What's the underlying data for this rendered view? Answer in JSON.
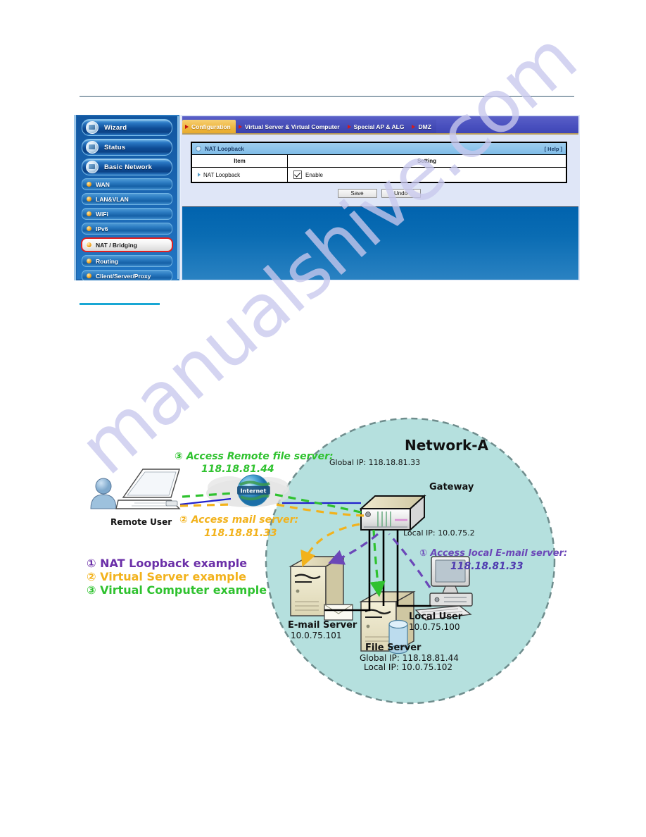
{
  "router_ui": {
    "sidebar": {
      "primary_items": [
        {
          "label": "Wizard",
          "icon": "wand-icon"
        },
        {
          "label": "Status",
          "icon": "chart-icon"
        },
        {
          "label": "Basic Network",
          "icon": "globe-icon"
        }
      ],
      "secondary_items": [
        {
          "label": "WAN",
          "active": false
        },
        {
          "label": "LAN&VLAN",
          "active": false
        },
        {
          "label": "WiFi",
          "active": false
        },
        {
          "label": "IPv6",
          "active": false
        },
        {
          "label": "NAT / Bridging",
          "active": true
        },
        {
          "label": "Routing",
          "active": false
        },
        {
          "label": "Client/Server/Proxy",
          "active": false
        }
      ]
    },
    "tabs": [
      {
        "label": "Configuration",
        "selected": true
      },
      {
        "label": "Virtual Server & Virtual Computer",
        "selected": false
      },
      {
        "label": "Special AP & ALG",
        "selected": false
      },
      {
        "label": "DMZ",
        "selected": false
      }
    ],
    "card": {
      "title": "NAT Loopback",
      "help_label": "[ Help ]",
      "columns": [
        "Item",
        "Setting"
      ],
      "rows": [
        {
          "item": "NAT Loopback",
          "setting_label": "Enable",
          "checked": true
        }
      ]
    },
    "buttons": {
      "save_label": "Save",
      "undo_label": "Undo"
    },
    "colors": {
      "selected_tab": "#eeb63f",
      "tab_bar": "#484fbe",
      "sidebar": "#1b63ab",
      "active_outline": "#e02020",
      "card_header": "#7fbde8"
    }
  },
  "diagram": {
    "network_label": "Network-A",
    "internet_label": "Internet",
    "nodes": {
      "remote_user": {
        "label": "Remote User"
      },
      "gateway": {
        "label": "Gateway",
        "global_ip": "Global IP: 118.18.81.33",
        "local_ip": "Local IP: 10.0.75.2"
      },
      "email_server": {
        "label": "E-mail Server",
        "ip": "10.0.75.101"
      },
      "file_server": {
        "label": "File Server",
        "global_ip": "Global IP: 118.18.81.44",
        "local_ip": "Local IP: 10.0.75.102"
      },
      "local_user": {
        "label": "Local User",
        "ip": "10.0.75.100"
      }
    },
    "flow_labels": [
      {
        "id": "flow-3",
        "line1": "③ Access Remote file server:",
        "line2": "118.18.81.44",
        "color": "#2fc22f"
      },
      {
        "id": "flow-2",
        "line1": "② Access mail server:",
        "line2": "118.18.81.33",
        "color": "#f2b21c"
      },
      {
        "id": "flow-1",
        "line1": "① Access local E-mail server:",
        "line2": "118.18.81.33",
        "color": "#6b47b8"
      }
    ],
    "legend": [
      {
        "text": "① NAT Loopback example",
        "color": "#6b2fa8"
      },
      {
        "text": "② Virtual Server example",
        "color": "#f2b21c"
      },
      {
        "text": "③ Virtual Computer example",
        "color": "#2fc22f"
      }
    ],
    "colors": {
      "network_fill": "#b5e0de",
      "network_border": "#6f8d8d"
    }
  },
  "watermark": {
    "text": "manualshive.com"
  }
}
